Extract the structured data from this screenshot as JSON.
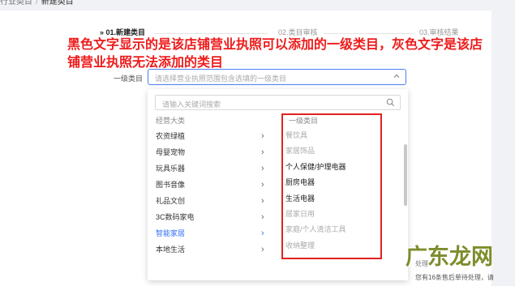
{
  "breadcrumb": {
    "parent": "行业类目",
    "current": "新建类目"
  },
  "steps": [
    {
      "label": "01.新建类目",
      "prefix": "»"
    },
    {
      "label": "02.类目审核"
    },
    {
      "label": "03.审核结果"
    }
  ],
  "annotation": "黑色文字显示的是该店铺营业执照可以添加的一级类目，灰色文字是该店铺营业执照无法添加的类目",
  "form": {
    "label": "一级类目",
    "select_placeholder": "请选择营业执照范围包含选填的一级类目"
  },
  "dropdown": {
    "search_placeholder": "请输入关键词搜索",
    "left_header": "经营大类",
    "left_items": [
      {
        "label": "农资绿植",
        "active": false
      },
      {
        "label": "母婴宠物",
        "active": false
      },
      {
        "label": "玩具乐器",
        "active": false
      },
      {
        "label": "图书音像",
        "active": false
      },
      {
        "label": "礼品文创",
        "active": false
      },
      {
        "label": "3C数码家电",
        "active": false
      },
      {
        "label": "智能家居",
        "active": true
      },
      {
        "label": "本地生活",
        "active": false
      }
    ],
    "right_header": "一级类目",
    "right_items": [
      {
        "label": "餐饮具",
        "enabled": false
      },
      {
        "label": "家居饰品",
        "enabled": false
      },
      {
        "label": "个人保健/护理电器",
        "enabled": true
      },
      {
        "label": "厨房电器",
        "enabled": true
      },
      {
        "label": "生活电器",
        "enabled": true
      },
      {
        "label": "居家日用",
        "enabled": false
      },
      {
        "label": "家庭/个人清洁工具",
        "enabled": false
      },
      {
        "label": "收纳整理",
        "enabled": false
      }
    ]
  },
  "bottom": {
    "right_text": "处理",
    "note": "您有16条售后单待处理，请"
  },
  "watermark": "广东龙网",
  "colors": {
    "accent": "#2f6df5",
    "annotation": "#ee1b1b",
    "highlight_box": "#e22222"
  }
}
